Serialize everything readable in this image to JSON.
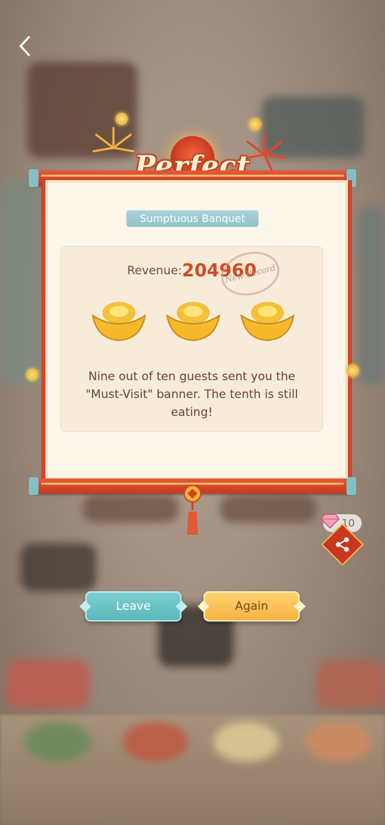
{
  "header": {
    "back_label": "back"
  },
  "banner": {
    "title": "Perfect Banquet",
    "subtitle": "Sumptuous Banquet"
  },
  "result": {
    "revenue_label": "Revenue:",
    "revenue_value": "204960",
    "record_stamp": "New Record",
    "ingots_earned": 3,
    "message": "Nine out of ten guests sent you the \"Must-Visit\" banner. The tenth is still eating!"
  },
  "share": {
    "gem_count": "10"
  },
  "buttons": {
    "leave_label": "Leave",
    "again_label": "Again"
  },
  "colors": {
    "accent_red": "#d14a24",
    "teal": "#5ab7bb",
    "gold": "#f6b13f",
    "paper": "#fbf5ea"
  }
}
